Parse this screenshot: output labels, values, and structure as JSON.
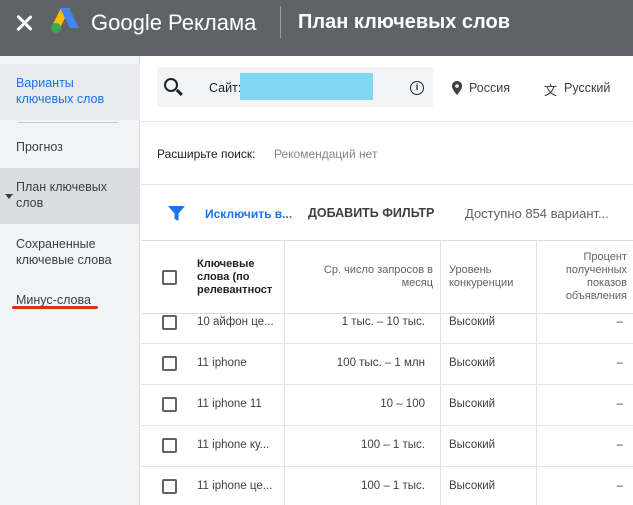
{
  "header": {
    "brand": "Google Реклама",
    "title": "План ключевых слов"
  },
  "sidebar": {
    "items": [
      {
        "label": "Варианты ключевых слов"
      },
      {
        "label": "Прогноз"
      },
      {
        "label": "План ключевых слов"
      },
      {
        "label": "Сохраненные ключевые слова"
      },
      {
        "label": "Минус-слова"
      }
    ]
  },
  "search": {
    "site_label": "Сайт:",
    "location": "Россия",
    "language": "Русский"
  },
  "expand": {
    "label": "Расширьте поиск:",
    "value": "Рекомендаций нет"
  },
  "toolbar": {
    "exclude": "Исключить в...",
    "add_filter": "ДОБАВИТЬ ФИЛЬТР",
    "available": "Доступно 854 вариант..."
  },
  "table": {
    "headers": {
      "keyword": "Ключевые слова (по релевантност",
      "volume": "Ср. число запросов в месяц",
      "competition": "Уровень конкуренции",
      "impression_share": "Процент полученных показов объявления"
    },
    "rows": [
      {
        "keyword": "10 айфон це...",
        "volume": "1 тыс. – 10 тыс.",
        "competition": "Высокий",
        "share": "–"
      },
      {
        "keyword": "11 iphone",
        "volume": "100 тыс. – 1 млн",
        "competition": "Высокий",
        "share": "–"
      },
      {
        "keyword": "11 iphone 11",
        "volume": "10 – 100",
        "competition": "Высокий",
        "share": "–"
      },
      {
        "keyword": "11 iphone ку...",
        "volume": "100 – 1 тыс.",
        "competition": "Высокий",
        "share": "–"
      },
      {
        "keyword": "11 iphone це...",
        "volume": "100 – 1 тыс.",
        "competition": "Высокий",
        "share": "–"
      }
    ]
  },
  "colors": {
    "header_bg": "#5f6368",
    "accent": "#1a73e8",
    "annotation_red": "#d93025",
    "redaction": "#82d6f0"
  }
}
